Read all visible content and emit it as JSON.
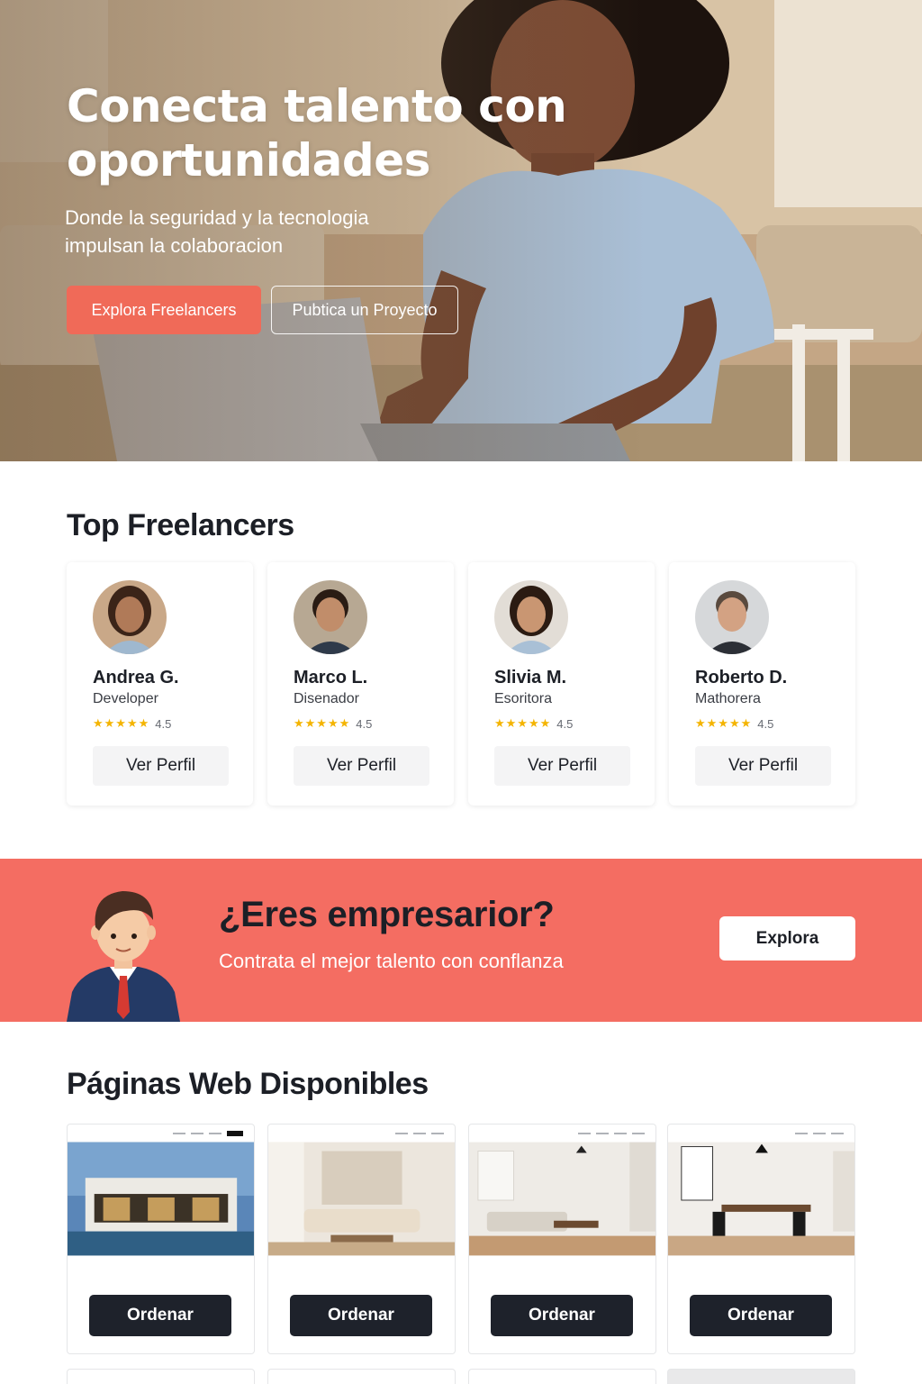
{
  "hero": {
    "title": "Conecta talento con oportunidades",
    "subtitle": "Donde la seguridad y la tecnologia impulsan la colaboracion",
    "primary_button": "Explora Freelancers",
    "secondary_button": "Pubtica un Proyecto"
  },
  "freelancers": {
    "title": "Top Freelancers",
    "items": [
      {
        "name": "Andrea G.",
        "role": "Developer",
        "rating": "4.5",
        "button": "Ver Perfil"
      },
      {
        "name": "Marco L.",
        "role": "Disenador",
        "rating": "4.5",
        "button": "Ver Perfil"
      },
      {
        "name": "Slivia M.",
        "role": "Esoritora",
        "rating": "4.5",
        "button": "Ver Perfil"
      },
      {
        "name": "Roberto D.",
        "role": "Mathorera",
        "rating": "4.5",
        "button": "Ver Perfil"
      }
    ],
    "stars": "★★★★★"
  },
  "banner": {
    "title": "¿Eres empresarior?",
    "subtitle": "Contrata el mejor talento con conflanza",
    "button": "Explora"
  },
  "web_pages": {
    "title": "Páginas Web Disponibles",
    "items": [
      {
        "button": "Ordenar"
      },
      {
        "button": "Ordenar"
      },
      {
        "button": "Ordenar"
      },
      {
        "button": "Ordenar"
      }
    ]
  },
  "colors": {
    "accent": "#f06a58",
    "banner": "#f46d62",
    "dark_button": "#1e222b",
    "star": "#f4b400"
  }
}
